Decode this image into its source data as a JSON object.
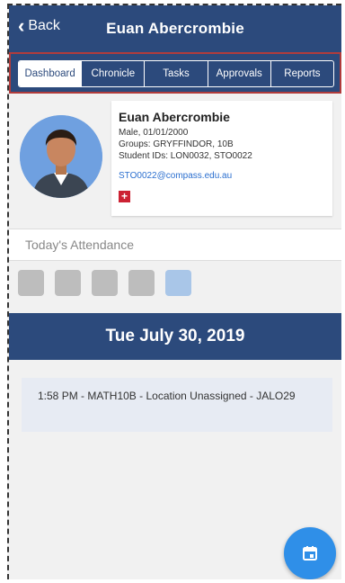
{
  "nav": {
    "back_label": "Back",
    "title": "Euan Abercrombie"
  },
  "tabs": [
    {
      "label": "Dashboard",
      "active": true
    },
    {
      "label": "Chronicle",
      "active": false
    },
    {
      "label": "Tasks",
      "active": false
    },
    {
      "label": "Approvals",
      "active": false
    },
    {
      "label": "Reports",
      "active": false
    }
  ],
  "profile": {
    "name": "Euan Abercrombie",
    "details": "Male, 01/01/2000",
    "groups": "Groups: GRYFFINDOR, 10B",
    "student_ids": "Student IDs: LON0032, STO0022",
    "email": "STO0022@compass.edu.au"
  },
  "attendance": {
    "label": "Today's Attendance",
    "squares": 5,
    "current_index": 4
  },
  "date_header": "Tue July 30, 2019",
  "events": [
    {
      "text": "1:58 PM - MATH10B - Location Unassigned - JALO29"
    }
  ],
  "colors": {
    "primary": "#2c4a7c",
    "fab": "#2f8fe8",
    "flag": "#cc2233",
    "square_past": "#bdbdbd",
    "square_current": "#a9c6e8"
  }
}
